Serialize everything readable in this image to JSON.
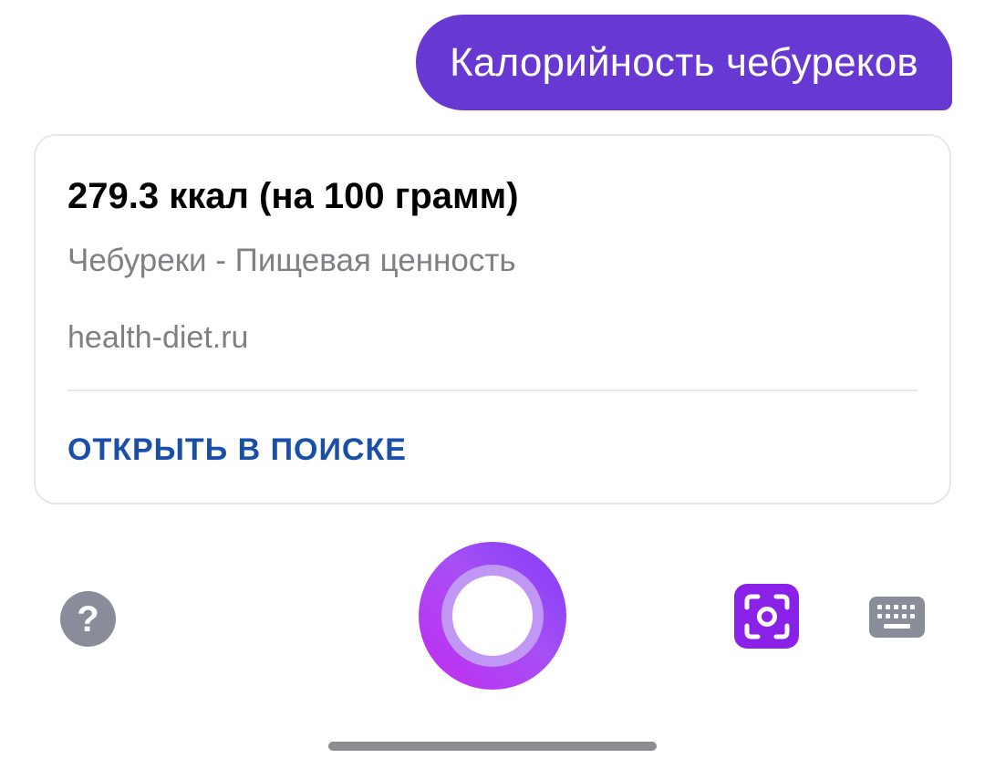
{
  "user_query": {
    "text": "Калорийность чебуреков"
  },
  "answer_card": {
    "title": "279.3 ккал (на 100 грамм)",
    "subtitle": "Чебуреки - Пищевая ценность",
    "source": "health-diet.ru",
    "action_label": "ОТКРЫТЬ В ПОИСКЕ"
  },
  "bottom_bar": {
    "help_icon": "question-mark-icon",
    "help_glyph": "?",
    "voice_icon": "alice-voice-icon",
    "camera_icon": "camera-scan-icon",
    "keyboard_icon": "keyboard-icon"
  },
  "colors": {
    "bubble": "#6838d2",
    "link": "#1a4fa8",
    "camera": "#8a21e8",
    "muted_icon": "#888d99"
  }
}
